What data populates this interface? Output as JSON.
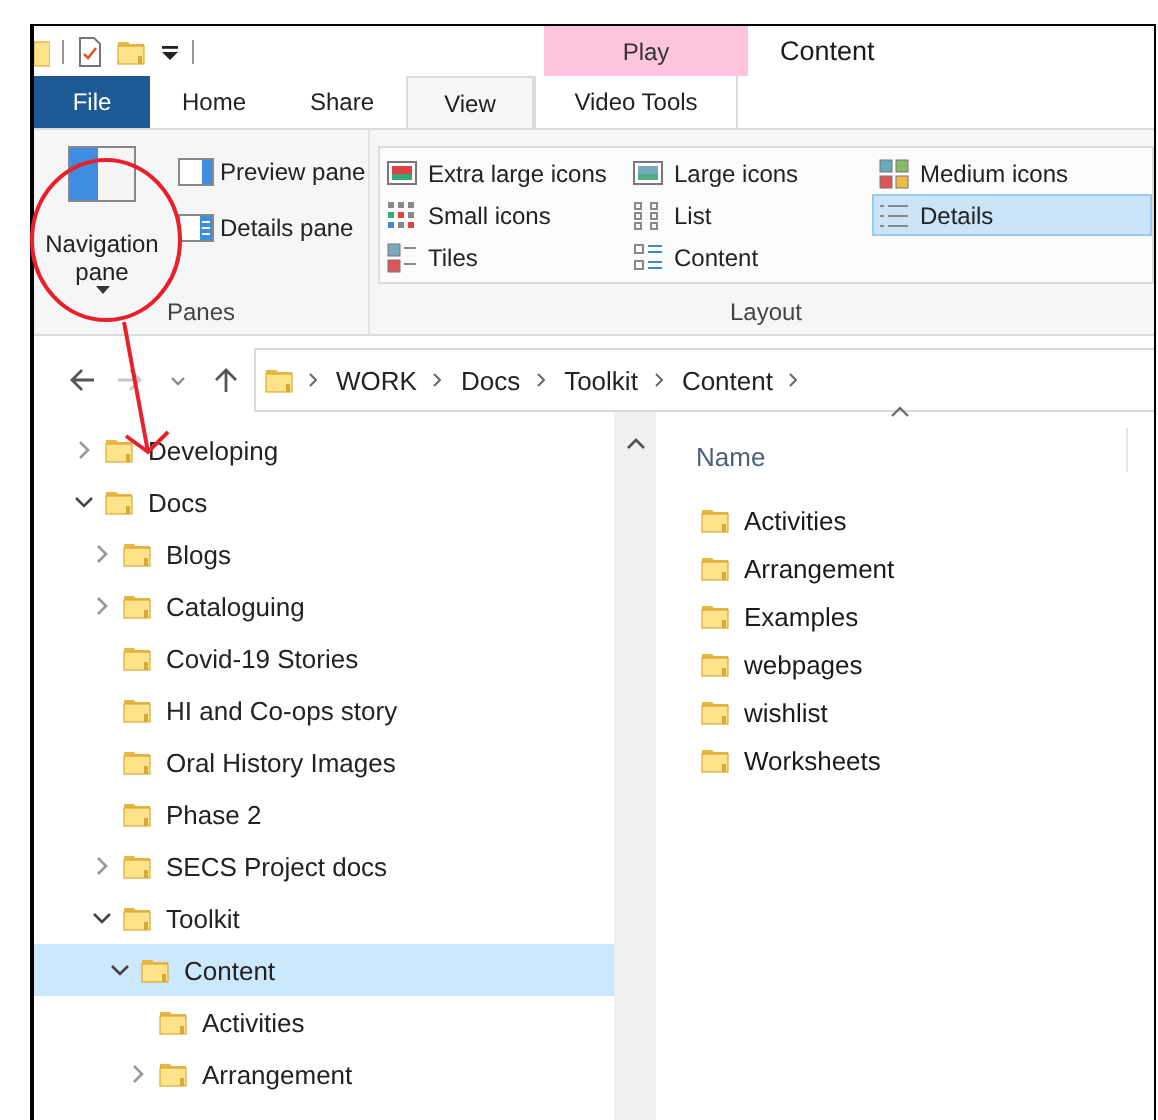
{
  "window": {
    "title": "Content"
  },
  "contextual_group": {
    "label": "Play"
  },
  "tabs": [
    {
      "label": "File",
      "kind": "file",
      "selected": false
    },
    {
      "label": "Home",
      "kind": "normal",
      "selected": false
    },
    {
      "label": "Share",
      "kind": "normal",
      "selected": false
    },
    {
      "label": "View",
      "kind": "normal",
      "selected": true
    },
    {
      "label": "Video Tools",
      "kind": "contextual",
      "selected": false
    }
  ],
  "panes_group": {
    "label": "Panes",
    "large_button": {
      "label": "Navigation pane"
    },
    "buttons": [
      {
        "label": "Preview pane"
      },
      {
        "label": "Details pane"
      }
    ]
  },
  "layout_group": {
    "label": "Layout",
    "options": [
      {
        "label": "Extra large icons",
        "selected": false
      },
      {
        "label": "Large icons",
        "selected": false
      },
      {
        "label": "Medium icons",
        "selected": false
      },
      {
        "label": "Small icons",
        "selected": false
      },
      {
        "label": "List",
        "selected": false
      },
      {
        "label": "Details",
        "selected": true
      },
      {
        "label": "Tiles",
        "selected": false
      },
      {
        "label": "Content",
        "selected": false
      }
    ]
  },
  "address_bar": {
    "path": [
      "WORK",
      "Docs",
      "Toolkit",
      "Content"
    ]
  },
  "navigation_tree": [
    {
      "label": "Developing",
      "expanded": false,
      "selected": false
    },
    {
      "label": "Docs",
      "expanded": true,
      "selected": false,
      "children": [
        {
          "label": "Blogs",
          "expanded": false,
          "selected": false
        },
        {
          "label": "Cataloguing",
          "expanded": false,
          "selected": false
        },
        {
          "label": "Covid-19 Stories",
          "selected": false
        },
        {
          "label": "HI and Co-ops story",
          "selected": false
        },
        {
          "label": "Oral History Images",
          "selected": false
        },
        {
          "label": "Phase 2",
          "selected": false
        },
        {
          "label": "SECS Project docs",
          "expanded": false,
          "selected": false
        },
        {
          "label": "Toolkit",
          "expanded": true,
          "selected": false,
          "children": [
            {
              "label": "Content",
              "expanded": true,
              "selected": true,
              "children": [
                {
                  "label": "Activities",
                  "selected": false
                },
                {
                  "label": "Arrangement",
                  "expanded": false,
                  "selected": false
                }
              ]
            }
          ]
        }
      ]
    }
  ],
  "file_list": {
    "columns": [
      {
        "label": "Name",
        "sort_ascending": true
      }
    ],
    "rows": [
      {
        "name": "Activities"
      },
      {
        "name": "Arrangement"
      },
      {
        "name": "Examples"
      },
      {
        "name": "webpages"
      },
      {
        "name": "wishlist"
      },
      {
        "name": "Worksheets"
      }
    ]
  }
}
